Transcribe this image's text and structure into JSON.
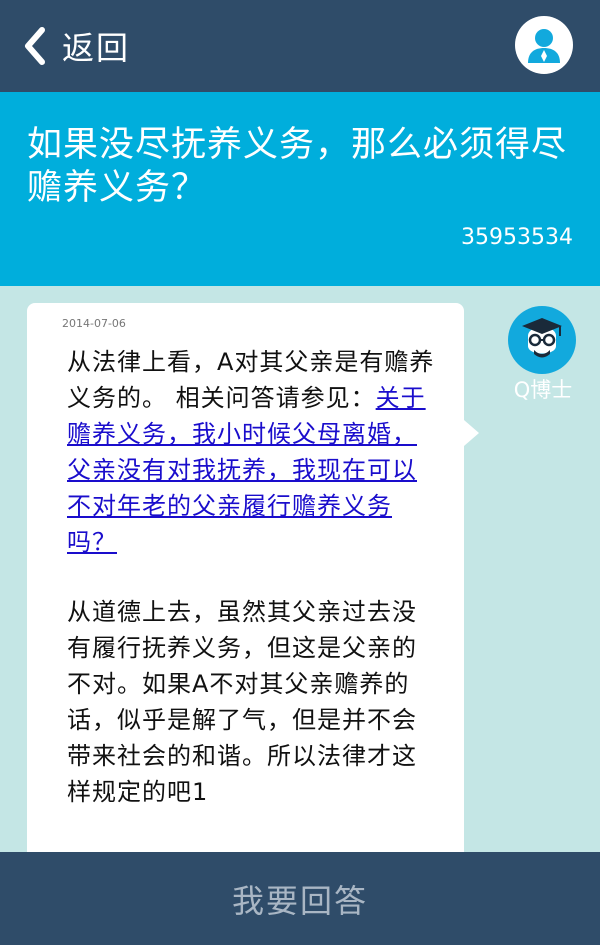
{
  "header": {
    "back_label": "返回",
    "back_icon": "chevron-left-icon",
    "user_icon": "user-avatar-icon"
  },
  "question": {
    "title": "如果没尽抚养义务，那么必须得尽赡养义务？",
    "id": "35953534"
  },
  "answer": {
    "date": "2014-07-06",
    "intro": "从法律上看，A对其父亲是有赡养义务的。 相关问答请参见：",
    "link_text": "关于赡养义务，我小时候父母离婚，父亲没有对我抚养，我现在可以不对年老的父亲履行赡养义务吗？",
    "body": "从道德上去，虽然其父亲过去没有履行抚养义务，但这是父亲的不对。如果A不对其父亲赡养的话，似乎是解了气，但是并不会带来社会的和谐。所以法律才这样规定的吧1",
    "author": "Q博士",
    "author_icon": "doctor-avatar-icon"
  },
  "footer": {
    "reply_label": "我要回答"
  },
  "colors": {
    "header_bg": "#2f4c69",
    "question_bg": "#00aedc",
    "page_bg": "#c4e6e5",
    "link": "#1a0dcc",
    "reply_text": "#a9b6c4"
  }
}
